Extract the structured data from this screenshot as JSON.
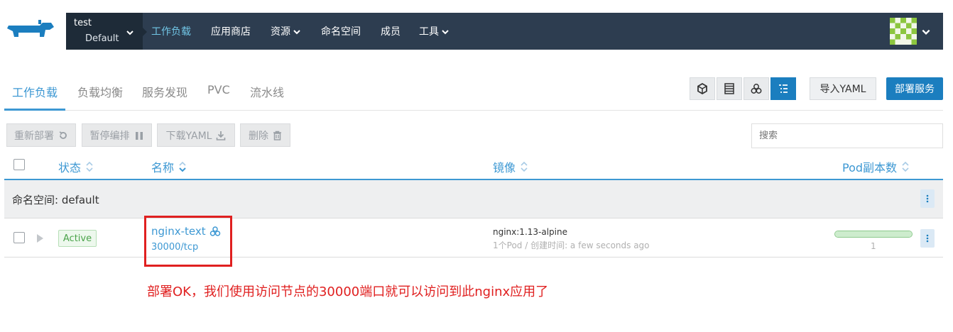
{
  "topnav": {
    "cluster_name": "test",
    "project_name": "Default",
    "items": [
      {
        "label": "工作负载",
        "active": true
      },
      {
        "label": "应用商店",
        "active": false
      },
      {
        "label": "资源",
        "dropdown": true
      },
      {
        "label": "命名空间",
        "active": false
      },
      {
        "label": "成员",
        "active": false
      },
      {
        "label": "工具",
        "dropdown": true
      }
    ],
    "colors": {
      "bar": "#2d3d50",
      "cluster_bg": "#1e2b38",
      "active": "#71c6e6",
      "logo": "#1b7ebf"
    }
  },
  "tabs": {
    "items": [
      "工作负载",
      "负载均衡",
      "服务发现",
      "PVC",
      "流水线"
    ],
    "active_index": 0,
    "view_icons": [
      "cube-icon",
      "list-icon",
      "cluster-icon",
      "group-list-icon"
    ],
    "import_yaml": "导入YAML",
    "deploy": "部署服务"
  },
  "actions": {
    "redeploy": "重新部署",
    "pause": "暂停编排",
    "download_yaml": "下载YAML",
    "delete": "删除",
    "search_placeholder": "搜索"
  },
  "table": {
    "headers": {
      "state": "状态",
      "name": "名称",
      "image": "镜像",
      "pods": "Pod副本数"
    },
    "group": {
      "label": "命名空间: default"
    },
    "rows": [
      {
        "state": "Active",
        "name": "nginx-text",
        "port": "30000/tcp",
        "image": "nginx:1.13-alpine",
        "meta": "1个Pod  /  创建时间: a few seconds ago",
        "pod_count": "1",
        "pod_progress": 1.0
      }
    ]
  },
  "annotation": {
    "text": "部署OK，我们使用访问节点的30000端口就可以访问到此nginx应用了",
    "color": "#e02020"
  }
}
